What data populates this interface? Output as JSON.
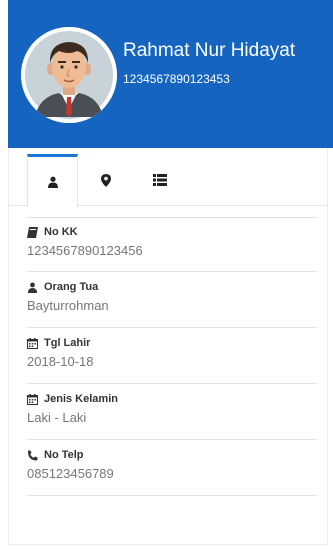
{
  "profile": {
    "name": "Rahmat Nur Hidayat",
    "id_number": "1234567890123453"
  },
  "tabs": [
    {
      "icon": "user-icon",
      "active": true
    },
    {
      "icon": "map-marker-icon",
      "active": false
    },
    {
      "icon": "list-icon",
      "active": false
    }
  ],
  "fields": {
    "no_kk": {
      "label": "No KK",
      "value": "1234567890123456",
      "icon": "book-icon"
    },
    "orang_tua": {
      "label": "Orang Tua",
      "value": "Bayturrohman",
      "icon": "user-icon"
    },
    "tgl_lahir": {
      "label": "Tgl Lahir",
      "value": "2018-10-18",
      "icon": "calendar-icon"
    },
    "jenis_kelamin": {
      "label": "Jenis Kelamin",
      "value": "Laki - Laki",
      "icon": "calendar-icon"
    },
    "no_telp": {
      "label": "No Telp",
      "value": "085123456789",
      "icon": "phone-icon"
    }
  },
  "colors": {
    "header_bg": "#1565c0",
    "tab_accent": "#1976d2"
  }
}
